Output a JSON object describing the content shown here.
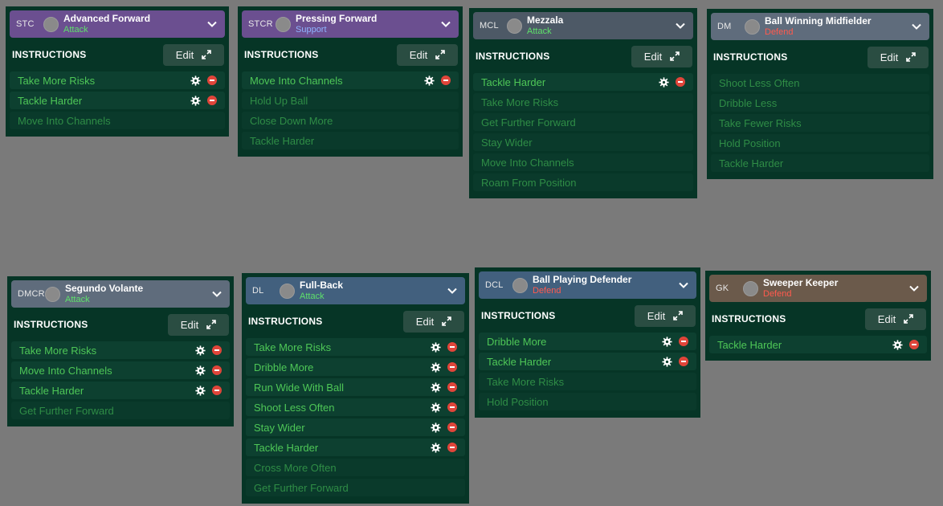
{
  "instructions_heading": "INSTRUCTIONS",
  "edit_label": "Edit",
  "cards": [
    {
      "position": "STC",
      "role": "Advanced Forward",
      "duty": "Attack",
      "instructions": [
        {
          "label": "Take More Risks",
          "active": true
        },
        {
          "label": "Tackle Harder",
          "active": true
        },
        {
          "label": "Move Into Channels",
          "active": false
        }
      ]
    },
    {
      "position": "STCR",
      "role": "Pressing Forward",
      "duty": "Support",
      "instructions": [
        {
          "label": "Move Into Channels",
          "active": true
        },
        {
          "label": "Hold Up Ball",
          "active": false
        },
        {
          "label": "Close Down More",
          "active": false
        },
        {
          "label": "Tackle Harder",
          "active": false
        }
      ]
    },
    {
      "position": "MCL",
      "role": "Mezzala",
      "duty": "Attack",
      "instructions": [
        {
          "label": "Tackle Harder",
          "active": true
        },
        {
          "label": "Take More Risks",
          "active": false
        },
        {
          "label": "Get Further Forward",
          "active": false
        },
        {
          "label": "Stay Wider",
          "active": false
        },
        {
          "label": "Move Into Channels",
          "active": false
        },
        {
          "label": "Roam From Position",
          "active": false
        }
      ]
    },
    {
      "position": "DM",
      "role": "Ball Winning Midfielder",
      "duty": "Defend",
      "instructions": [
        {
          "label": "Shoot Less Often",
          "active": false
        },
        {
          "label": "Dribble Less",
          "active": false
        },
        {
          "label": "Take Fewer Risks",
          "active": false
        },
        {
          "label": "Hold Position",
          "active": false
        },
        {
          "label": "Tackle Harder",
          "active": false
        }
      ]
    },
    {
      "position": "DMCR",
      "role": "Segundo Volante",
      "duty": "Attack",
      "instructions": [
        {
          "label": "Take More Risks",
          "active": true
        },
        {
          "label": "Move Into Channels",
          "active": true
        },
        {
          "label": "Tackle Harder",
          "active": true
        },
        {
          "label": "Get Further Forward",
          "active": false
        }
      ]
    },
    {
      "position": "DL",
      "role": "Full-Back",
      "duty": "Attack",
      "instructions": [
        {
          "label": "Take More Risks",
          "active": true
        },
        {
          "label": "Dribble More",
          "active": true
        },
        {
          "label": "Run Wide With Ball",
          "active": true
        },
        {
          "label": "Shoot Less Often",
          "active": true
        },
        {
          "label": "Stay Wider",
          "active": true
        },
        {
          "label": "Tackle Harder",
          "active": true
        },
        {
          "label": "Cross More Often",
          "active": false
        },
        {
          "label": "Get Further Forward",
          "active": false
        }
      ]
    },
    {
      "position": "DCL",
      "role": "Ball Playing Defender",
      "duty": "Defend",
      "instructions": [
        {
          "label": "Dribble More",
          "active": true
        },
        {
          "label": "Tackle Harder",
          "active": true
        },
        {
          "label": "Take More Risks",
          "active": false
        },
        {
          "label": "Hold Position",
          "active": false
        }
      ]
    },
    {
      "position": "GK",
      "role": "Sweeper Keeper",
      "duty": "Defend",
      "instructions": [
        {
          "label": "Tackle Harder",
          "active": true
        }
      ]
    }
  ],
  "colors": {
    "panel_bg": "#063526",
    "active_text": "#4ec757",
    "inactive_text": "#2f8d46",
    "attack": "#5ee06b",
    "support": "#8fb4ff",
    "defend": "#ff5a4e",
    "remove": "#e0453a"
  },
  "icons": [
    "player-avatar",
    "chevron-down-icon",
    "expand-icon",
    "gear-icon",
    "remove-icon"
  ]
}
